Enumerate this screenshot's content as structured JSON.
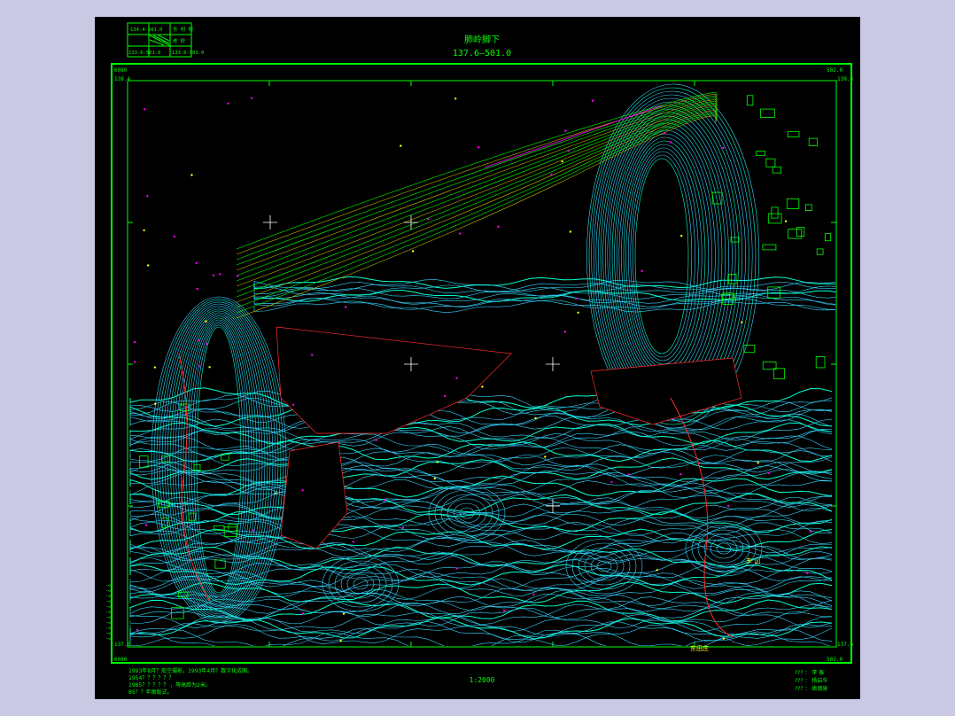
{
  "map": {
    "title": "肺岭脚下",
    "sheet_number": "137.6—501.0",
    "scale": "1:2000",
    "corner_labels": {
      "top_left_x": "6080",
      "top_left_y": "138.4",
      "top_right_x": "502.0",
      "top_right_y": "138.4",
      "bottom_left_x": "6080",
      "bottom_left_y": "137.6",
      "bottom_right_x": "502.0",
      "bottom_right_y": "137.6"
    },
    "index_grid": {
      "cells": [
        "134.4-501.0",
        "东 村 桥",
        "",
        "老 岭",
        "133.6-501.0",
        "133.6-502.0"
      ]
    },
    "notes": [
      "1993年8月？航空摄影，1993年4月？数字化成图。",
      "1954？？？？？？",
      "1985？？？？？ ，等高距为2米。",
      "85？？年图版式。"
    ],
    "credits": [
      "??? ：  李  泰",
      "??? ：  杨启华",
      "??? ：  姚德泉"
    ],
    "left_margin_note": "？？？？？？？？？？？",
    "place_names": [
      "东田庄",
      "古 溪",
      "东 山"
    ],
    "colors": {
      "frame": "#00ff00",
      "contour_index": "#00ffcc",
      "contour_minor": "#33d6ff",
      "elevation_label": "#ff00ff",
      "road": "#ff2b2b",
      "building": "#00ff00",
      "annotation": "#ffff00",
      "desk_background": "#c9c9e4"
    }
  }
}
